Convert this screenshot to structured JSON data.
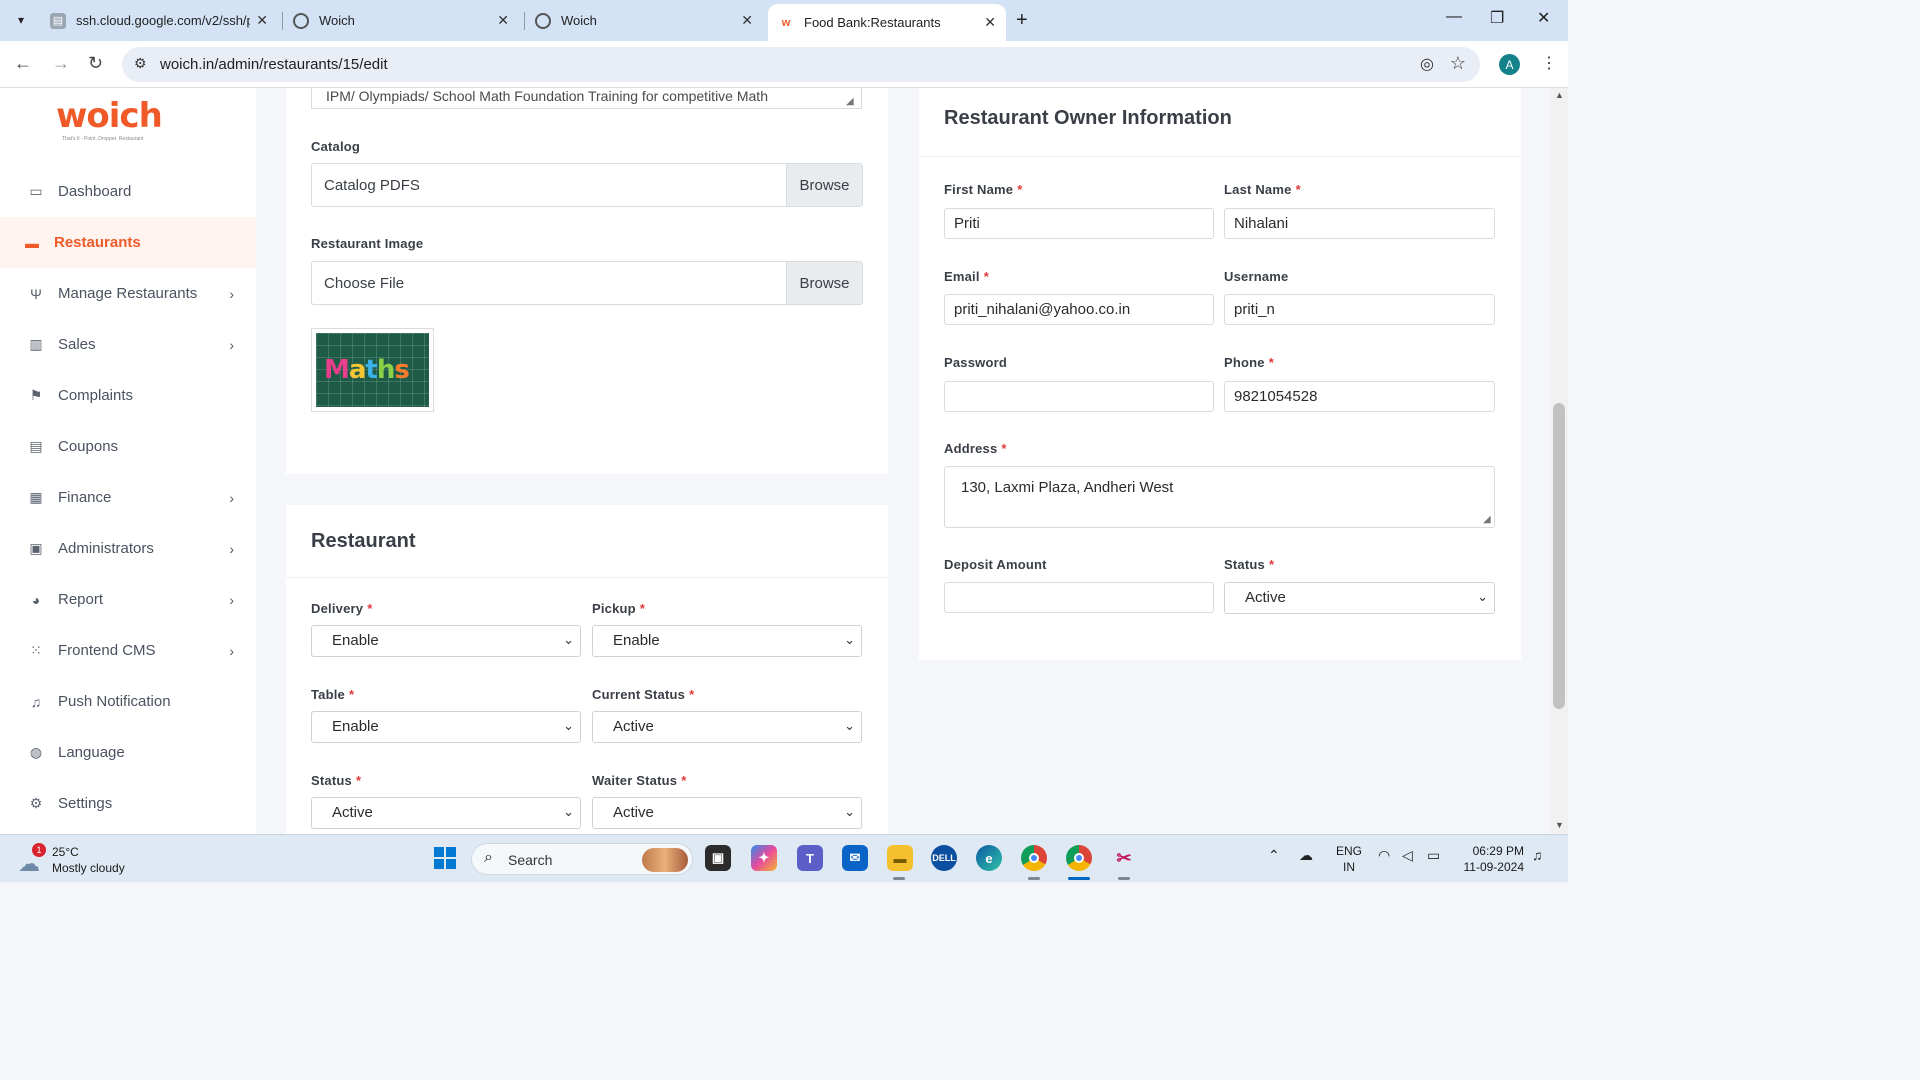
{
  "browser": {
    "tabs": [
      {
        "title": "ssh.cloud.google.com/v2/ssh/p",
        "favicon": "terminal-icon"
      },
      {
        "title": "Woich",
        "favicon": "globe-icon"
      },
      {
        "title": "Woich",
        "favicon": "globe-icon"
      },
      {
        "title": "Food Bank:Restaurants",
        "favicon": "woich-icon"
      }
    ],
    "url": "woich.in/admin/restaurants/15/edit",
    "profile_initial": "A"
  },
  "sidebar": {
    "logo_text": "woich",
    "logo_tagline": "That's It - Point. Dropper. Restaurant",
    "items": [
      {
        "label": "Dashboard",
        "icon": "monitor-icon",
        "chevron": false
      },
      {
        "label": "Restaurants",
        "icon": "store-icon",
        "chevron": false
      },
      {
        "label": "Manage Restaurants",
        "icon": "cutlery-icon",
        "chevron": true
      },
      {
        "label": "Sales",
        "icon": "bar-chart-icon",
        "chevron": true
      },
      {
        "label": "Complaints",
        "icon": "flag-icon",
        "chevron": false
      },
      {
        "label": "Coupons",
        "icon": "ticket-icon",
        "chevron": false
      },
      {
        "label": "Finance",
        "icon": "money-icon",
        "chevron": true
      },
      {
        "label": "Administrators",
        "icon": "id-card-icon",
        "chevron": true
      },
      {
        "label": "Report",
        "icon": "pie-chart-icon",
        "chevron": true
      },
      {
        "label": "Frontend CMS",
        "icon": "grid-icon",
        "chevron": true
      },
      {
        "label": "Push Notification",
        "icon": "bell-icon",
        "chevron": false
      },
      {
        "label": "Language",
        "icon": "globe-icon",
        "chevron": false
      },
      {
        "label": "Settings",
        "icon": "gears-icon",
        "chevron": false
      }
    ],
    "active_item": "Restaurants"
  },
  "left_form": {
    "description_text": "IPM/ Olympiads/ School Math Foundation Training for competitive Math",
    "catalog": {
      "label": "Catalog",
      "placeholder": "Catalog PDFS",
      "button": "Browse"
    },
    "restaurant_image": {
      "label": "Restaurant Image",
      "placeholder": "Choose File",
      "button": "Browse",
      "preview_text": "Maths"
    }
  },
  "restaurant_card": {
    "title": "Restaurant",
    "fields": {
      "delivery": {
        "label": "Delivery",
        "value": "Enable"
      },
      "pickup": {
        "label": "Pickup",
        "value": "Enable"
      },
      "table": {
        "label": "Table",
        "value": "Enable"
      },
      "current_status": {
        "label": "Current Status",
        "value": "Active"
      },
      "status": {
        "label": "Status",
        "value": "Active"
      },
      "waiter_status": {
        "label": "Waiter Status",
        "value": "Active"
      }
    }
  },
  "owner_card": {
    "title": "Restaurant Owner Information",
    "first_name": {
      "label": "First Name",
      "value": "Priti"
    },
    "last_name": {
      "label": "Last Name",
      "value": "Nihalani"
    },
    "email": {
      "label": "Email",
      "value": "priti_nihalani@yahoo.co.in"
    },
    "username": {
      "label": "Username",
      "value": "priti_n"
    },
    "password": {
      "label": "Password",
      "value": ""
    },
    "phone": {
      "label": "Phone",
      "value": "9821054528"
    },
    "address": {
      "label": "Address",
      "value": "130, Laxmi Plaza, Andheri West"
    },
    "deposit": {
      "label": "Deposit Amount",
      "value": ""
    },
    "status": {
      "label": "Status",
      "value": "Active"
    }
  },
  "required_mark": "*",
  "taskbar": {
    "weather_badge": "1",
    "temperature": "25°C",
    "condition": "Mostly cloudy",
    "search_label": "Search",
    "lang_line1": "ENG",
    "lang_line2": "IN",
    "time": "06:29 PM",
    "date": "11-09-2024"
  },
  "colors": {
    "accent": "#f05a28",
    "required": "#e03b3b"
  }
}
